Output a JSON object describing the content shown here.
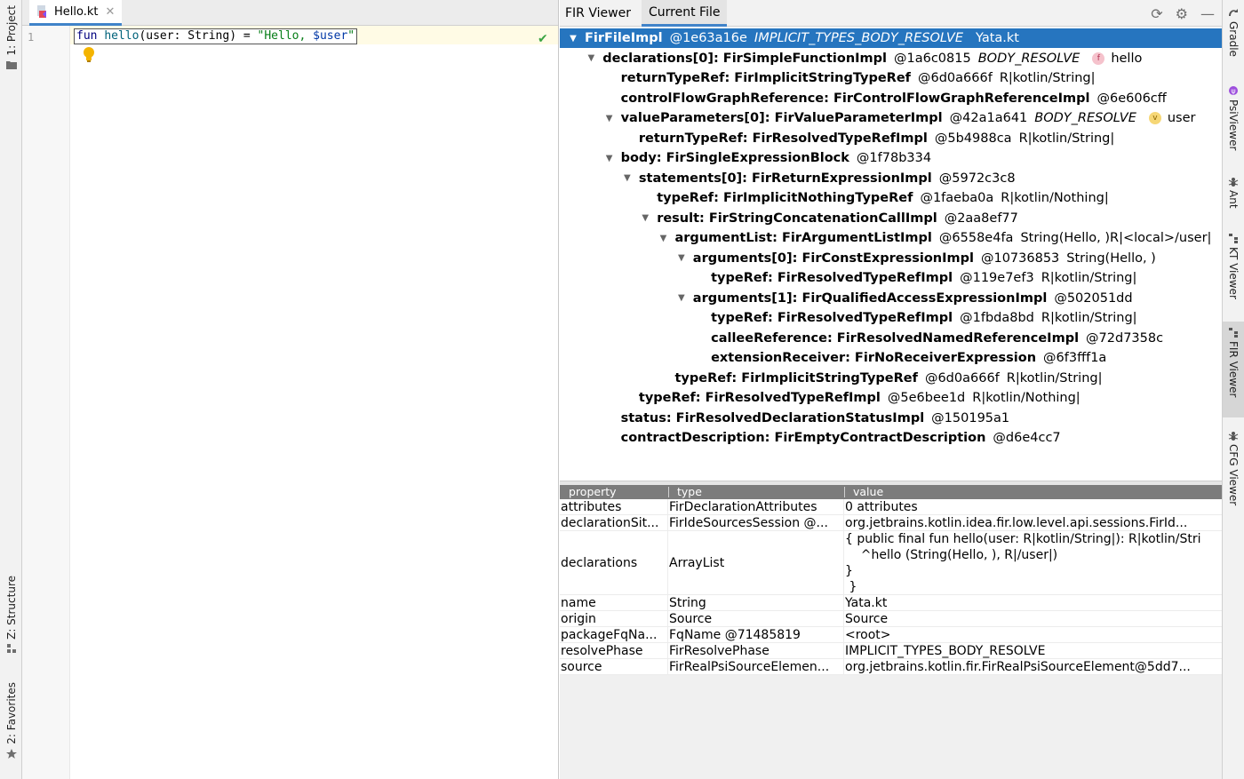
{
  "left_strip": {
    "project": "1: Project",
    "structure": "Z: Structure",
    "favorites": "2: Favorites"
  },
  "right_strip": {
    "gradle": "Gradle",
    "psiviewer": "PsiViewer",
    "ant": "Ant",
    "ktviewer": "KT Viewer",
    "firviewer": "FIR Viewer",
    "cfgviewer": "CFG Viewer"
  },
  "editor": {
    "tab_label": "Hello.kt",
    "line_number": "1",
    "code": {
      "kw": "fun",
      "fn": "hello",
      "params": "(user: String) = ",
      "str1": "\"Hello, ",
      "tmpl": "$user",
      "str2": "\""
    }
  },
  "fir": {
    "title": "FIR Viewer",
    "tab": "Current File",
    "tree": [
      {
        "arrow": "▼",
        "name": "FirFileImpl",
        "hash": "@1e63a16e",
        "phase": "IMPLICIT_TYPES_BODY_RESOLVE",
        "extra": "Yata.kt"
      },
      {
        "arrow": "▼",
        "name": "declarations[0]: FirSimpleFunctionImpl",
        "hash": "@1a6c0815",
        "phase": "BODY_RESOLVE",
        "badge": "f",
        "extra": "hello"
      },
      {
        "arrow": "",
        "name": "returnTypeRef: FirImplicitStringTypeRef",
        "hash": "@6d0a666f",
        "ref": "R|kotlin/String|"
      },
      {
        "arrow": "",
        "name": "controlFlowGraphReference: FirControlFlowGraphReferenceImpl",
        "hash": "@6e606cff"
      },
      {
        "arrow": "▼",
        "name": "valueParameters[0]: FirValueParameterImpl",
        "hash": "@42a1a641",
        "phase": "BODY_RESOLVE",
        "badge": "v",
        "extra": "user"
      },
      {
        "arrow": "",
        "name": "returnTypeRef: FirResolvedTypeRefImpl",
        "hash": "@5b4988ca",
        "ref": "R|kotlin/String|"
      },
      {
        "arrow": "▼",
        "name": "body: FirSingleExpressionBlock",
        "hash": "@1f78b334"
      },
      {
        "arrow": "▼",
        "name": "statements[0]: FirReturnExpressionImpl",
        "hash": "@5972c3c8"
      },
      {
        "arrow": "",
        "name": "typeRef: FirImplicitNothingTypeRef",
        "hash": "@1faeba0a",
        "ref": "R|kotlin/Nothing|"
      },
      {
        "arrow": "▼",
        "name": "result: FirStringConcatenationCallImpl",
        "hash": "@2aa8ef77"
      },
      {
        "arrow": "▼",
        "name": "argumentList: FirArgumentListImpl",
        "hash": "@6558e4fa",
        "ref": "String(Hello, )R|<local>/user|"
      },
      {
        "arrow": "▼",
        "name": "arguments[0]: FirConstExpressionImpl",
        "hash": "@10736853",
        "ref": "String(Hello, )"
      },
      {
        "arrow": "",
        "name": "typeRef: FirResolvedTypeRefImpl",
        "hash": "@119e7ef3",
        "ref": "R|kotlin/String|"
      },
      {
        "arrow": "▼",
        "name": "arguments[1]: FirQualifiedAccessExpressionImpl",
        "hash": "@502051dd"
      },
      {
        "arrow": "",
        "name": "typeRef: FirResolvedTypeRefImpl",
        "hash": "@1fbda8bd",
        "ref": "R|kotlin/String|"
      },
      {
        "arrow": "",
        "name": "calleeReference: FirResolvedNamedReferenceImpl",
        "hash": "@72d7358c"
      },
      {
        "arrow": "",
        "name": "extensionReceiver: FirNoReceiverExpression",
        "hash": "@6f3fff1a"
      },
      {
        "arrow": "",
        "name": "typeRef: FirImplicitStringTypeRef",
        "hash": "@6d0a666f",
        "ref": "R|kotlin/String|"
      },
      {
        "arrow": "",
        "name": "typeRef: FirResolvedTypeRefImpl",
        "hash": "@5e6bee1d",
        "ref": "R|kotlin/Nothing|"
      },
      {
        "arrow": "",
        "name": "status: FirResolvedDeclarationStatusImpl",
        "hash": "@150195a1"
      },
      {
        "arrow": "",
        "name": "contractDescription: FirEmptyContractDescription",
        "hash": "@d6e4cc7"
      }
    ],
    "table": {
      "headers": [
        "property",
        "type",
        "value"
      ],
      "rows": [
        {
          "p": "attributes",
          "t": "FirDeclarationAttributes",
          "v": [
            "0 attributes"
          ]
        },
        {
          "p": "declarationSit...",
          "t": "FirIdeSourcesSession @...",
          "v": [
            "org.jetbrains.kotlin.idea.fir.low.level.api.sessions.FirId..."
          ]
        },
        {
          "p": "declarations",
          "t": "ArrayList",
          "v": [
            "{ public final fun hello(user: R|kotlin/String|): R|kotlin/Stri",
            "    ^hello (String(Hello, ), R|/user|)",
            "}",
            " }"
          ]
        },
        {
          "p": "name",
          "t": "String",
          "v": [
            "Yata.kt"
          ]
        },
        {
          "p": "origin",
          "t": "Source",
          "v": [
            "Source"
          ]
        },
        {
          "p": "packageFqNa...",
          "t": "FqName @71485819",
          "v": [
            "<root>"
          ]
        },
        {
          "p": "resolvePhase",
          "t": "FirResolvePhase",
          "v": [
            "IMPLICIT_TYPES_BODY_RESOLVE"
          ]
        },
        {
          "p": "source",
          "t": "FirRealPsiSourceElemen...",
          "v": [
            "org.jetbrains.kotlin.fir.FirRealPsiSourceElement@5dd7..."
          ]
        }
      ]
    }
  }
}
